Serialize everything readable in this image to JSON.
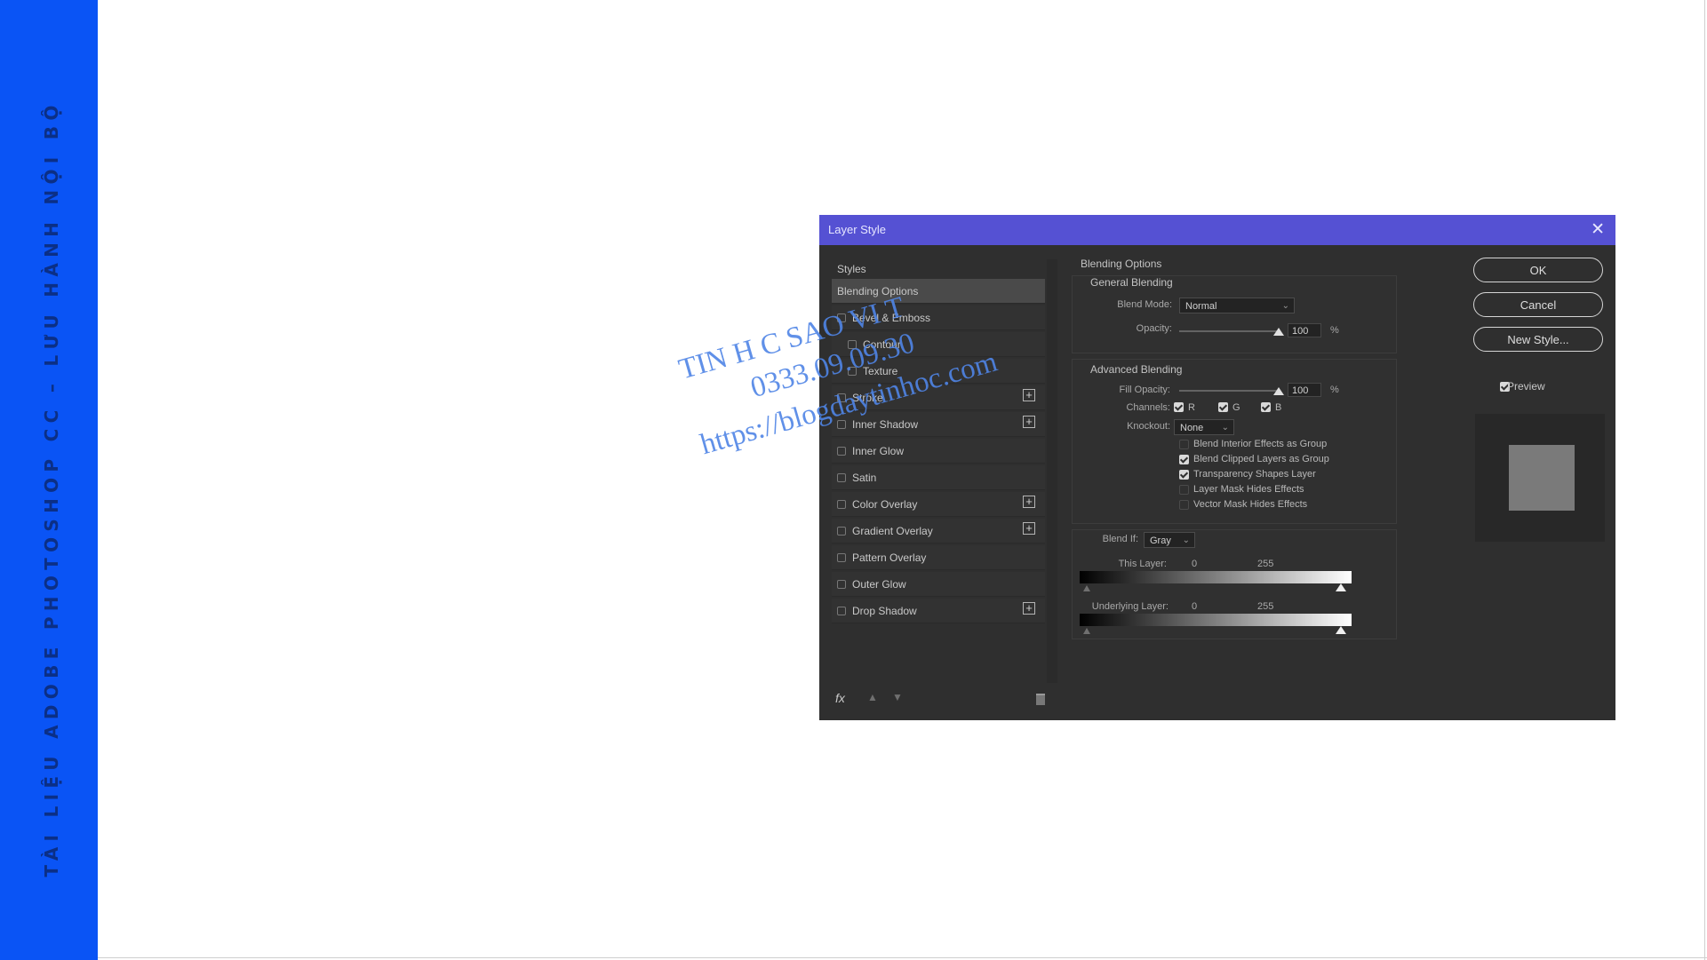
{
  "sidebar": {
    "text": "TÀI LIỆU ADOBE PHOTOSHOP CC – LƯU HÀNH NỘI BỘ"
  },
  "dialog": {
    "title": "Layer Style",
    "styles_header": "Styles",
    "style_items": [
      {
        "label": "Blending Options",
        "active": true,
        "checkbox": false,
        "sub": false,
        "plus": false
      },
      {
        "label": "Bevel & Emboss",
        "active": false,
        "checkbox": true,
        "sub": false,
        "plus": false
      },
      {
        "label": "Contour",
        "active": false,
        "checkbox": true,
        "sub": true,
        "plus": false
      },
      {
        "label": "Texture",
        "active": false,
        "checkbox": true,
        "sub": true,
        "plus": false
      },
      {
        "label": "Stroke",
        "active": false,
        "checkbox": true,
        "sub": false,
        "plus": true
      },
      {
        "label": "Inner Shadow",
        "active": false,
        "checkbox": true,
        "sub": false,
        "plus": true
      },
      {
        "label": "Inner Glow",
        "active": false,
        "checkbox": true,
        "sub": false,
        "plus": false
      },
      {
        "label": "Satin",
        "active": false,
        "checkbox": true,
        "sub": false,
        "plus": false
      },
      {
        "label": "Color Overlay",
        "active": false,
        "checkbox": true,
        "sub": false,
        "plus": true
      },
      {
        "label": "Gradient Overlay",
        "active": false,
        "checkbox": true,
        "sub": false,
        "plus": true
      },
      {
        "label": "Pattern Overlay",
        "active": false,
        "checkbox": true,
        "sub": false,
        "plus": false
      },
      {
        "label": "Outer Glow",
        "active": false,
        "checkbox": true,
        "sub": false,
        "plus": false
      },
      {
        "label": "Drop Shadow",
        "active": false,
        "checkbox": true,
        "sub": false,
        "plus": true
      }
    ],
    "fx_label": "fx",
    "blending": {
      "section_title": "Blending Options",
      "general_title": "General Blending",
      "blend_mode_label": "Blend Mode:",
      "blend_mode_value": "Normal",
      "opacity_label": "Opacity:",
      "opacity_value": "100",
      "opacity_percent": 1.0,
      "unit": "%",
      "advanced_title": "Advanced Blending",
      "fill_opacity_label": "Fill Opacity:",
      "fill_opacity_value": "100",
      "fill_opacity_percent": 1.0,
      "channels_label": "Channels:",
      "channels": [
        {
          "label": "R",
          "checked": true
        },
        {
          "label": "G",
          "checked": true
        },
        {
          "label": "B",
          "checked": true
        }
      ],
      "knockout_label": "Knockout:",
      "knockout_value": "None",
      "options": [
        {
          "label": "Blend Interior Effects as Group",
          "checked": false
        },
        {
          "label": "Blend Clipped Layers as Group",
          "checked": true
        },
        {
          "label": "Transparency Shapes Layer",
          "checked": true
        },
        {
          "label": "Layer Mask Hides Effects",
          "checked": false
        },
        {
          "label": "Vector Mask Hides Effects",
          "checked": false
        }
      ],
      "blend_if_label": "Blend If:",
      "blend_if_value": "Gray",
      "this_layer_label": "This Layer:",
      "this_layer_min": "0",
      "this_layer_max": "255",
      "underlying_layer_label": "Underlying Layer:",
      "underlying_min": "0",
      "underlying_max": "255"
    },
    "buttons": {
      "ok": "OK",
      "cancel": "Cancel",
      "new_style": "New Style...",
      "preview": "Preview",
      "preview_checked": true
    }
  },
  "watermark": {
    "line1": "TIN H   C SAO VI   T",
    "line2": "0333.09.09.30",
    "line3": "https://blogdaytinhoc.com"
  }
}
